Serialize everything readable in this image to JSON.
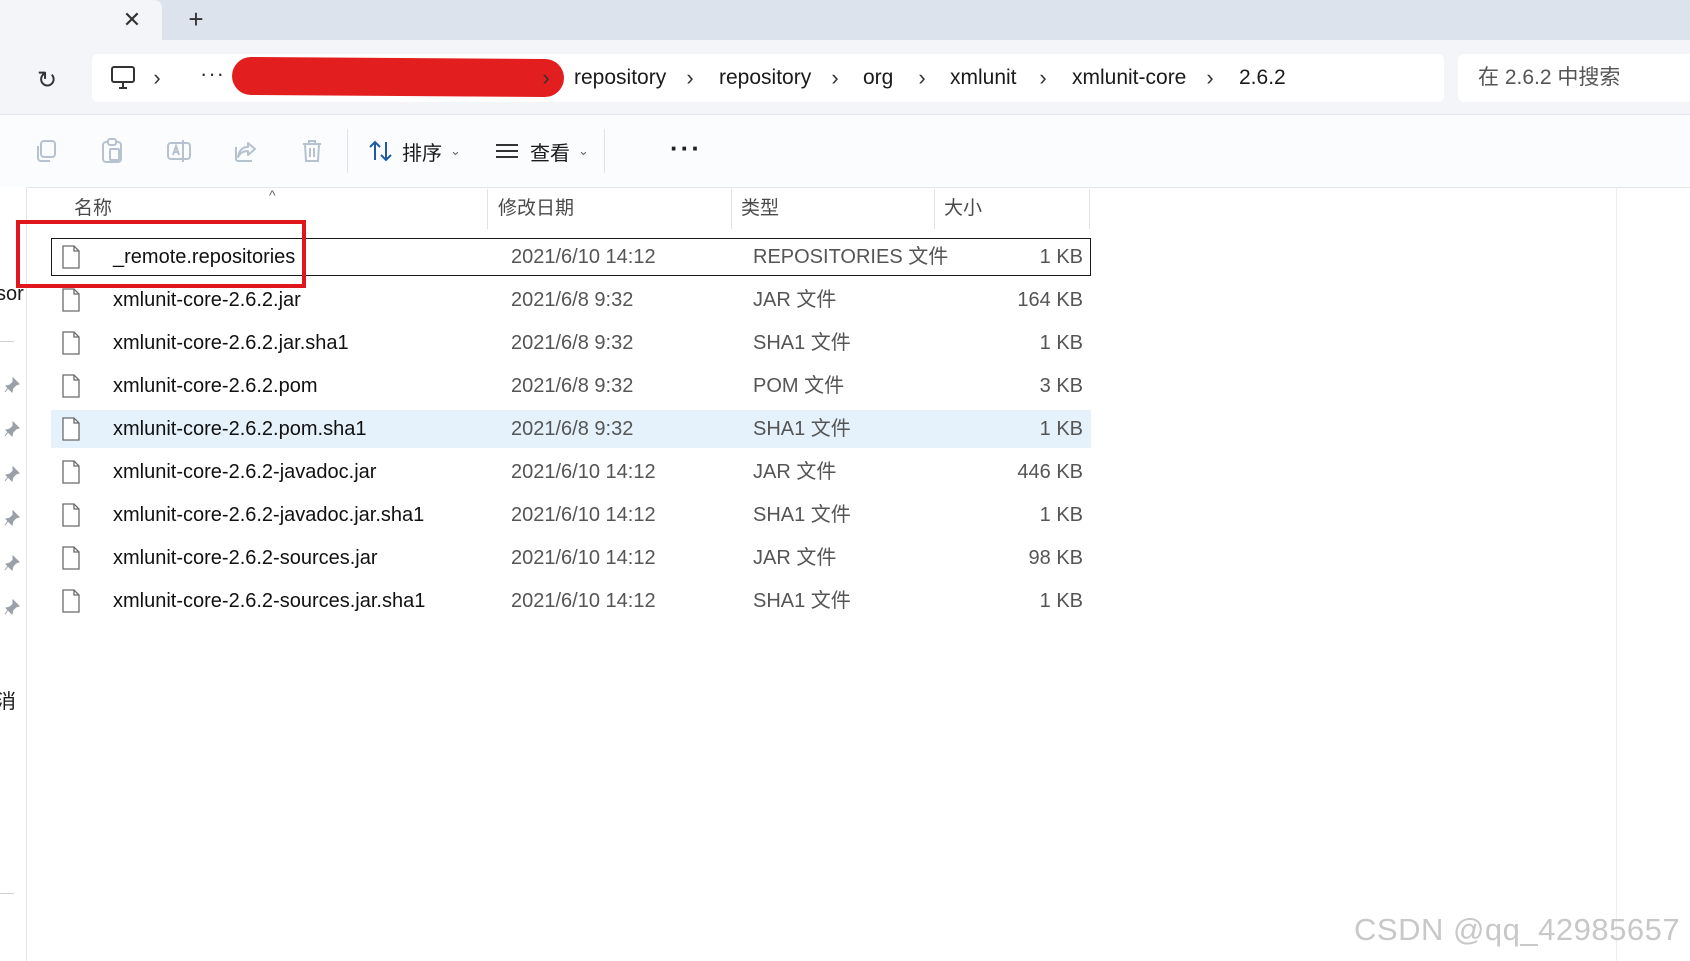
{
  "tab": {
    "close_glyph": "✕",
    "new_glyph": "+"
  },
  "address_bar": {
    "refresh_glyph": "↻",
    "more_glyph": "···",
    "breadcrumb": [
      "repository",
      "repository",
      "org",
      "xmlunit",
      "xmlunit-core",
      "2.6.2"
    ],
    "chevron": "›"
  },
  "search": {
    "placeholder": "在 2.6.2 中搜索"
  },
  "toolbar": {
    "sort_label": "排序",
    "view_label": "查看",
    "more_glyph": "···",
    "caret": "⌄"
  },
  "left_nav": {
    "clipped_text_top": "sor",
    "clipped_text_bottom": "消"
  },
  "columns": {
    "name": "名称",
    "date": "修改日期",
    "type": "类型",
    "size": "大小",
    "sort_indicator": "^"
  },
  "files": [
    {
      "name": "_remote.repositories",
      "date": "2021/6/10 14:12",
      "type": "REPOSITORIES 文件",
      "size": "1 KB"
    },
    {
      "name": "xmlunit-core-2.6.2.jar",
      "date": "2021/6/8 9:32",
      "type": "JAR 文件",
      "size": "164 KB"
    },
    {
      "name": "xmlunit-core-2.6.2.jar.sha1",
      "date": "2021/6/8 9:32",
      "type": "SHA1 文件",
      "size": "1 KB"
    },
    {
      "name": "xmlunit-core-2.6.2.pom",
      "date": "2021/6/8 9:32",
      "type": "POM 文件",
      "size": "3 KB"
    },
    {
      "name": "xmlunit-core-2.6.2.pom.sha1",
      "date": "2021/6/8 9:32",
      "type": "SHA1 文件",
      "size": "1 KB"
    },
    {
      "name": "xmlunit-core-2.6.2-javadoc.jar",
      "date": "2021/6/10 14:12",
      "type": "JAR 文件",
      "size": "446 KB"
    },
    {
      "name": "xmlunit-core-2.6.2-javadoc.jar.sha1",
      "date": "2021/6/10 14:12",
      "type": "SHA1 文件",
      "size": "1 KB"
    },
    {
      "name": "xmlunit-core-2.6.2-sources.jar",
      "date": "2021/6/10 14:12",
      "type": "JAR 文件",
      "size": "98 KB"
    },
    {
      "name": "xmlunit-core-2.6.2-sources.jar.sha1",
      "date": "2021/6/10 14:12",
      "type": "SHA1 文件",
      "size": "1 KB"
    }
  ],
  "watermark": "CSDN @qq_42985657",
  "colors": {
    "highlight_box": "#e0161f",
    "redaction": "#e31e1e",
    "hover_row": "#e5f1fb",
    "tab_strip": "#dde3ec"
  }
}
